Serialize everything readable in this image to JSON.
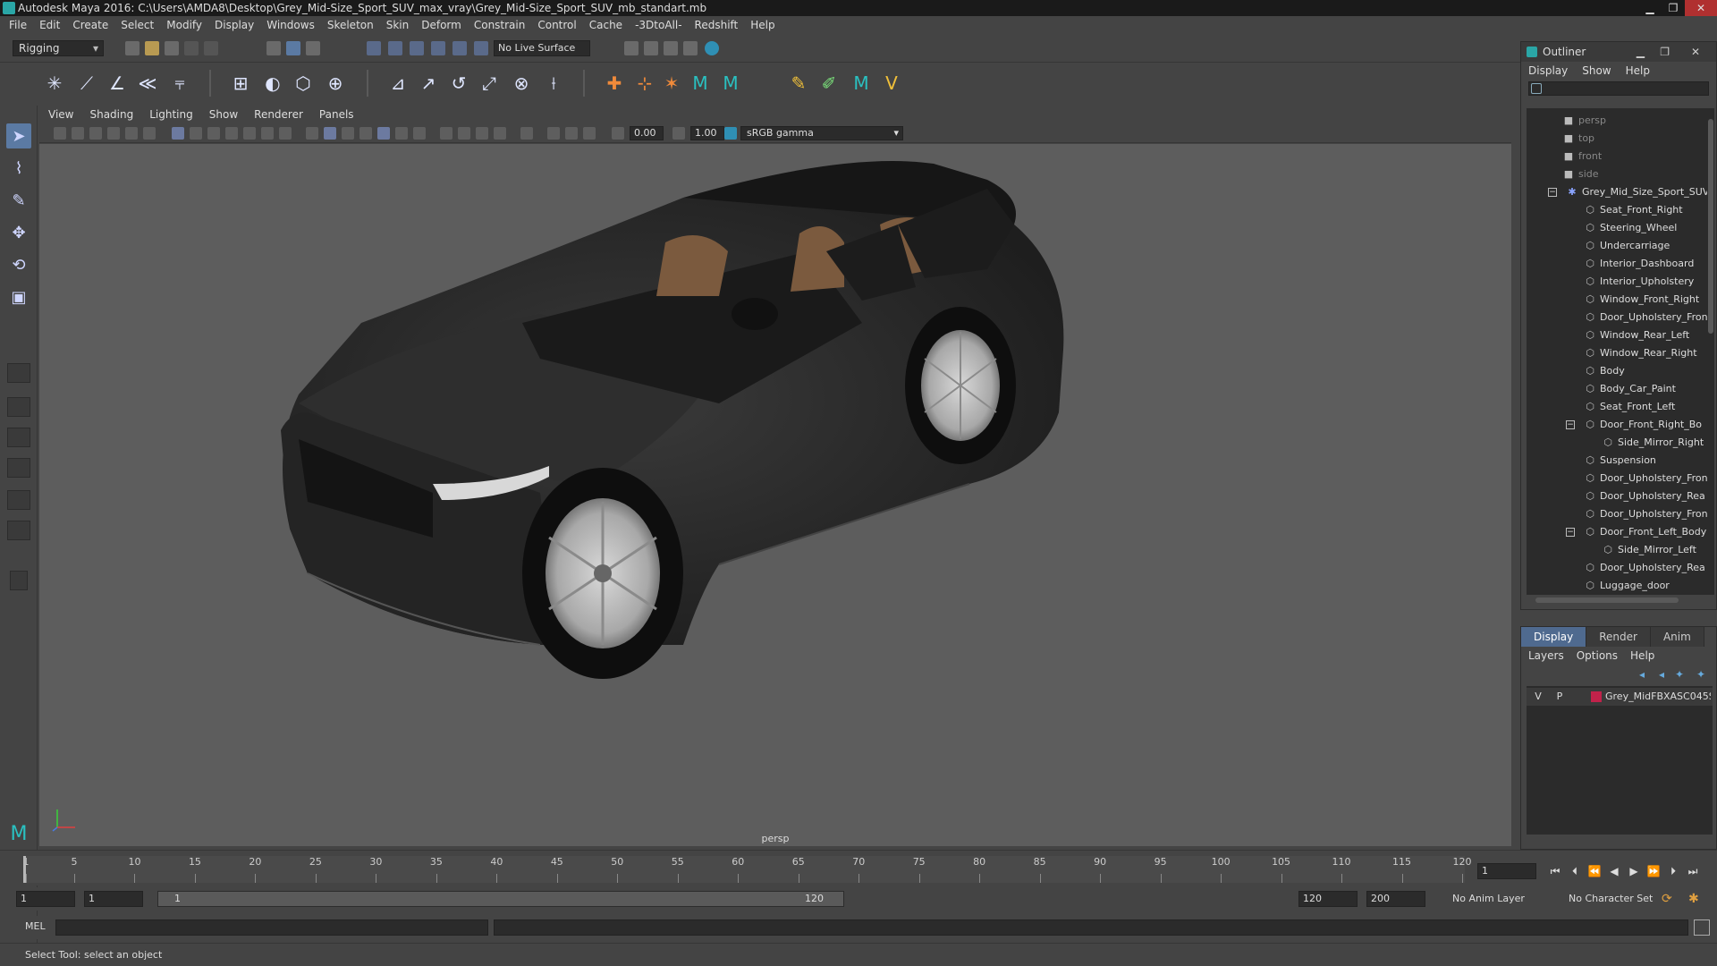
{
  "window": {
    "title": "Autodesk Maya 2016: C:\\Users\\AMDA8\\Desktop\\Grey_Mid-Size_Sport_SUV_max_vray\\Grey_Mid-Size_Sport_SUV_mb_standart.mb",
    "minimize": "▁",
    "maximize": "❐",
    "close": "✕"
  },
  "menu": [
    "File",
    "Edit",
    "Create",
    "Select",
    "Modify",
    "Display",
    "Windows",
    "Skeleton",
    "Skin",
    "Deform",
    "Constrain",
    "Control",
    "Cache",
    "-3DtoAll-",
    "Redshift",
    "Help"
  ],
  "statusline": {
    "mode": "Rigging",
    "live_surface": "No Live Surface"
  },
  "panel": {
    "menu": [
      "View",
      "Shading",
      "Lighting",
      "Show",
      "Renderer",
      "Panels"
    ],
    "exposure": "0.00",
    "gamma": "1.00",
    "color_space": "sRGB gamma",
    "camera_label": "persp"
  },
  "outliner": {
    "title": "Outliner",
    "menu": [
      "Display",
      "Show",
      "Help"
    ],
    "cameras": [
      "persp",
      "top",
      "front",
      "side"
    ],
    "root": "Grey_Mid_Size_Sport_SUV",
    "items": [
      {
        "label": "Seat_Front_Right",
        "depth": 1
      },
      {
        "label": "Steering_Wheel",
        "depth": 1
      },
      {
        "label": "Undercarriage",
        "depth": 1
      },
      {
        "label": "Interior_Dashboard",
        "depth": 1
      },
      {
        "label": "Interior_Upholstery",
        "depth": 1
      },
      {
        "label": "Window_Front_Right",
        "depth": 1
      },
      {
        "label": "Door_Upholstery_Fron",
        "depth": 1
      },
      {
        "label": "Window_Rear_Left",
        "depth": 1
      },
      {
        "label": "Window_Rear_Right",
        "depth": 1
      },
      {
        "label": "Body",
        "depth": 1
      },
      {
        "label": "Body_Car_Paint",
        "depth": 1
      },
      {
        "label": "Seat_Front_Left",
        "depth": 1
      },
      {
        "label": "Door_Front_Right_Bo",
        "depth": 1,
        "expanded": true
      },
      {
        "label": "Side_Mirror_Right",
        "depth": 2
      },
      {
        "label": "Suspension",
        "depth": 1
      },
      {
        "label": "Door_Upholstery_Fron",
        "depth": 1
      },
      {
        "label": "Door_Upholstery_Rea",
        "depth": 1
      },
      {
        "label": "Door_Upholstery_Fron",
        "depth": 1
      },
      {
        "label": "Door_Front_Left_Body",
        "depth": 1,
        "expanded": true
      },
      {
        "label": "Side_Mirror_Left",
        "depth": 2
      },
      {
        "label": "Door_Upholstery_Rea",
        "depth": 1
      },
      {
        "label": "Luggage_door",
        "depth": 1
      }
    ]
  },
  "layer_editor": {
    "tabs": [
      "Display",
      "Render",
      "Anim"
    ],
    "active_tab": "Display",
    "menu": [
      "Layers",
      "Options",
      "Help"
    ],
    "layer": {
      "v": "V",
      "p": "P",
      "name": "Grey_MidFBXASC045Si",
      "color": "#c1224a"
    }
  },
  "timeslider": {
    "ticks": [
      1,
      5,
      10,
      15,
      20,
      25,
      30,
      35,
      40,
      45,
      50,
      55,
      60,
      65,
      70,
      75,
      80,
      85,
      90,
      95,
      100,
      105,
      110,
      115,
      120
    ],
    "min": 1,
    "max": 120,
    "current_frame": "1"
  },
  "rangeslider": {
    "start": "1",
    "playback_start": "1",
    "bar_start": "1",
    "bar_end": "120",
    "playback_end": "120",
    "end": "200",
    "anim_layer": "No Anim Layer",
    "character_set": "No Character Set"
  },
  "cmdline": {
    "label": "MEL"
  },
  "helpline": {
    "text": "Select Tool: select an object"
  }
}
